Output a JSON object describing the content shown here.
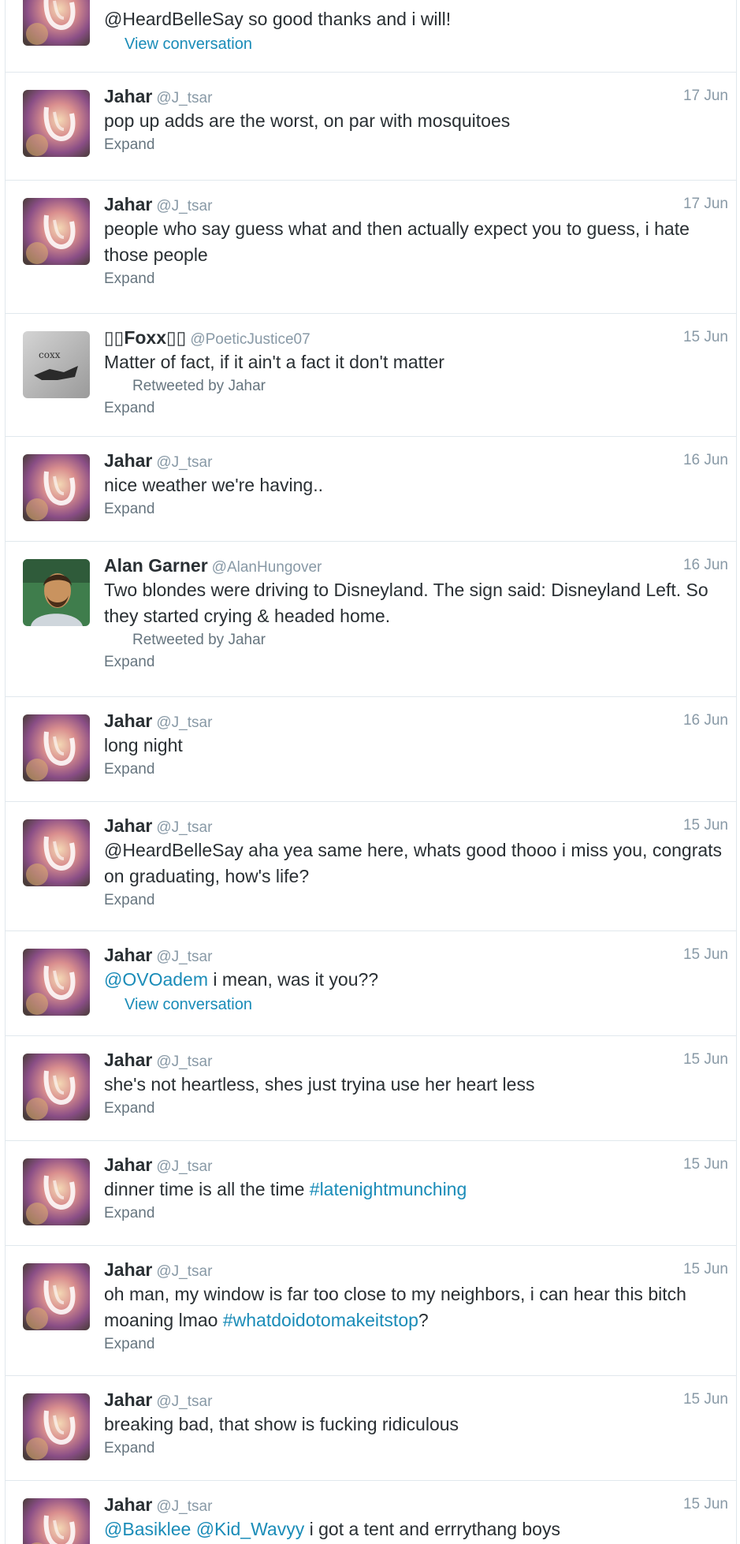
{
  "tweets": [
    {
      "partial": true,
      "avatar": "jahar-avatar",
      "text_parts": [
        "@HeardBelleSay so good thanks and i will!"
      ],
      "action": "View conversation"
    },
    {
      "name": "Jahar",
      "handle": "@J_tsar",
      "time": "17 Jun",
      "avatar": "jahar-avatar",
      "text_parts": [
        "pop up adds are the worst, on par with mosquitoes"
      ],
      "action": "Expand"
    },
    {
      "name": "Jahar",
      "handle": "@J_tsar",
      "time": "17 Jun",
      "avatar": "jahar-avatar",
      "text_parts": [
        "people who say guess what and then actually expect you to guess, i hate those people"
      ],
      "action": "Expand"
    },
    {
      "name": "▯▯Foxx▯▯",
      "handle": "@PoeticJustice07",
      "time": "15 Jun",
      "avatar": "foxx-avatar",
      "text_parts": [
        "Matter of fact, if it ain't a fact it don't matter"
      ],
      "retweeted": "Retweeted by Jahar",
      "action": "Expand"
    },
    {
      "name": "Jahar",
      "handle": "@J_tsar",
      "time": "16 Jun",
      "avatar": "jahar-avatar",
      "text_parts": [
        "nice weather we're having.."
      ],
      "action": "Expand"
    },
    {
      "name": "Alan Garner",
      "handle": "@AlanHungover",
      "time": "16 Jun",
      "avatar": "alan-avatar",
      "text_parts": [
        "Two blondes were driving to Disneyland. The sign said: Disneyland Left. So they started crying & headed home."
      ],
      "retweeted": "Retweeted by Jahar",
      "action": "Expand"
    },
    {
      "name": "Jahar",
      "handle": "@J_tsar",
      "time": "16 Jun",
      "avatar": "jahar-avatar",
      "text_parts": [
        "long night"
      ],
      "action": "Expand"
    },
    {
      "name": "Jahar",
      "handle": "@J_tsar",
      "time": "15 Jun",
      "avatar": "jahar-avatar",
      "text_parts": [
        "@HeardBelleSay aha yea same here, whats good thooo i miss you, congrats on graduating, how's life?"
      ],
      "action": "Expand"
    },
    {
      "name": "Jahar",
      "handle": "@J_tsar",
      "time": "15 Jun",
      "avatar": "jahar-avatar",
      "text_parts": [
        {
          "link": "@OVOadem"
        },
        " i mean, was it you??"
      ],
      "action": "View conversation"
    },
    {
      "name": "Jahar",
      "handle": "@J_tsar",
      "time": "15 Jun",
      "avatar": "jahar-avatar",
      "text_parts": [
        "she's not heartless, shes just tryina use her heart less"
      ],
      "action": "Expand"
    },
    {
      "name": "Jahar",
      "handle": "@J_tsar",
      "time": "15 Jun",
      "avatar": "jahar-avatar",
      "text_parts": [
        "dinner time is all the time ",
        {
          "link": "#latenightmunching"
        }
      ],
      "action": "Expand"
    },
    {
      "name": "Jahar",
      "handle": "@J_tsar",
      "time": "15 Jun",
      "avatar": "jahar-avatar",
      "text_parts": [
        "oh man, my window is far too close to my neighbors, i can hear this bitch moaning lmao ",
        {
          "link": "#whatdoidotomakeitstop"
        },
        "?"
      ],
      "action": "Expand"
    },
    {
      "name": "Jahar",
      "handle": "@J_tsar",
      "time": "15 Jun",
      "avatar": "jahar-avatar",
      "text_parts": [
        "breaking bad, that show is fucking ridiculous"
      ],
      "action": "Expand"
    },
    {
      "name": "Jahar",
      "handle": "@J_tsar",
      "time": "15 Jun",
      "avatar": "jahar-avatar",
      "text_parts": [
        {
          "link": "@Basiklee"
        },
        " ",
        {
          "link": "@Kid_Wavyy"
        },
        " i got a tent and errrythang boys"
      ]
    }
  ],
  "colors": {
    "name": "#292f33",
    "meta": "#8899a6",
    "link": "#1a8cb8",
    "divider": "#e1e8ed"
  }
}
